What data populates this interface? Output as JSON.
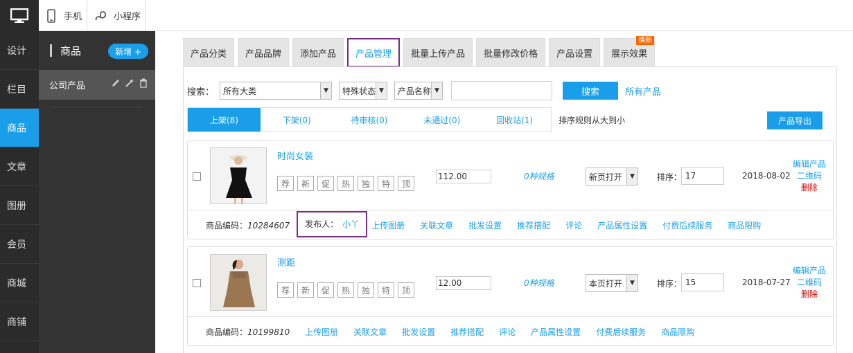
{
  "topbar": {
    "phone_label": "手机",
    "miniapp_label": "小程序"
  },
  "leftnav": {
    "items": [
      "设计",
      "栏目",
      "商品",
      "文章",
      "图册",
      "会员",
      "商城",
      "商铺"
    ],
    "active_index": 2
  },
  "subnav": {
    "title": "商品",
    "add_label": "新增 +",
    "item_label": "公司产品"
  },
  "tabs": [
    "产品分类",
    "产品品牌",
    "添加产品",
    "产品管理",
    "批量上传产品",
    "批量修改价格",
    "产品设置",
    "展示效果"
  ],
  "active_tab": "产品管理",
  "tab_badge": "焕新",
  "search": {
    "label": "搜索：",
    "category": "所有大类",
    "status": "特殊状态",
    "field": "产品名称",
    "keyword": "",
    "button": "搜索",
    "all_link": "所有产品"
  },
  "status_tabs": [
    "上架(8)",
    "下架(0)",
    "待审核(0)",
    "未通过(0)",
    "回收站(1)"
  ],
  "sort_rule": "排序规则从大到小",
  "export_button": "产品导出",
  "flags": [
    "荐",
    "新",
    "促",
    "热",
    "独",
    "特",
    "顶"
  ],
  "products": [
    {
      "name": "时尚女装",
      "price": "112.00",
      "spec": "0种规格",
      "open": "新页打开",
      "sort_label": "排序：",
      "sort": "17",
      "date": "2018-08-02",
      "code_label": "商品编码：",
      "code": "10284607",
      "publisher_label": "发布人：",
      "publisher": "小丫",
      "links": [
        "上传图册",
        "关联文章",
        "批发设置",
        "推荐搭配",
        "评论",
        "产品属性设置",
        "付费后续服务",
        "商品限购"
      ],
      "edit": "编辑产品",
      "qr": "二维码",
      "del": "删除"
    },
    {
      "name": "测距",
      "price": "12.00",
      "spec": "0种规格",
      "open": "本页打开",
      "sort_label": "排序：",
      "sort": "15",
      "date": "2018-07-27",
      "code_label": "商品编码：",
      "code": "10199810",
      "links": [
        "上传图册",
        "关联文章",
        "批发设置",
        "推荐搭配",
        "评论",
        "产品属性设置",
        "付费后续服务",
        "商品限购"
      ],
      "edit": "编辑产品",
      "qr": "二维码",
      "del": "删除"
    }
  ]
}
